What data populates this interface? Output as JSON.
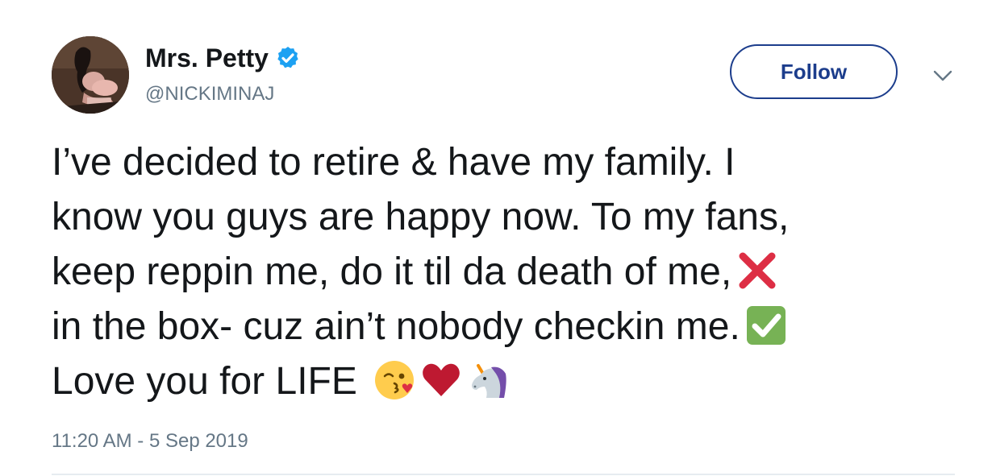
{
  "user": {
    "display_name": "Mrs. Petty",
    "handle": "@NICKIMINAJ",
    "verified": true
  },
  "actions": {
    "follow_label": "Follow"
  },
  "tweet": {
    "lines": [
      "I’ve decided to retire & have my family. I",
      "know you guys are happy now. To my fans,",
      "keep reppin me, do it til da death of me,",
      "in the box- cuz ain’t nobody checkin me.",
      "Love you for LIFE"
    ],
    "emojis": {
      "line3": "cross-mark-emoji",
      "line4": "check-mark-button-emoji",
      "line5": [
        "face-blowing-kiss-emoji",
        "red-heart-emoji",
        "unicorn-emoji"
      ]
    },
    "timestamp": "11:20 AM - 5 Sep 2019"
  },
  "colors": {
    "text": "#14171a",
    "secondary_text": "#657786",
    "follow_accent": "#1c3d8c",
    "verified_blue": "#1da1f2",
    "cross_red": "#dd2e44",
    "check_green": "#77b255",
    "heart_red": "#be1931",
    "divider": "#e6ecf0"
  }
}
